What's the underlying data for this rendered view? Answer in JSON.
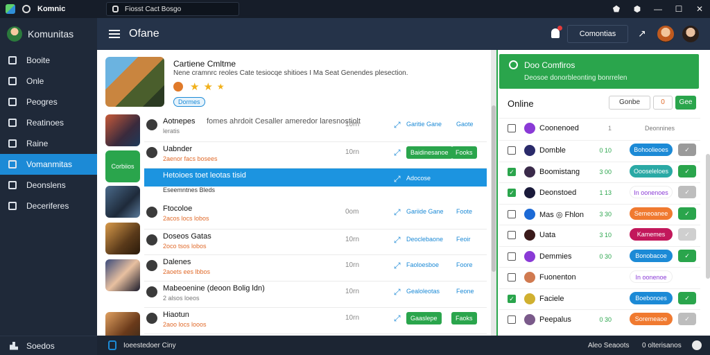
{
  "titlebar": {
    "title": "Komnic",
    "search": "Fiosst Cact Bosgo",
    "controls": [
      "⬟",
      "⬢",
      "—",
      "☐",
      "✕"
    ]
  },
  "sidebar": {
    "user": "Komunitas",
    "items": [
      {
        "label": "Booite",
        "icon": "square-icon"
      },
      {
        "label": "Onle",
        "icon": "circle-icon"
      },
      {
        "label": "Peogres",
        "icon": "tag-icon"
      },
      {
        "label": "Reatinoes",
        "icon": "people-icon"
      },
      {
        "label": "Raine",
        "icon": "badge-icon"
      },
      {
        "label": "Vomanmitas",
        "icon": "globe-icon",
        "active": true
      },
      {
        "label": "Deonslens",
        "icon": "card-icon"
      },
      {
        "label": "Deceriferes",
        "icon": "chat-icon"
      }
    ],
    "footer": "Soedos"
  },
  "header": {
    "title": "Ofane",
    "button": "Comontias",
    "arrow": "↗"
  },
  "featured": {
    "title": "Cartiene Cmltme",
    "desc": "Nene cramnrc reoles Cate tesiocqe shitioes I Ma Seat Genendes plesection.",
    "badge": "Dormes"
  },
  "rows": [
    {
      "name": "Aotnepes",
      "sub": "leratis",
      "sub_gray": true,
      "extra": "fomes ahrdoit Cesaller ameredor laresnostiolt",
      "time": "10rn",
      "link": "Garitie Gane",
      "tag": "Gaote"
    },
    {
      "name": "Uabnder",
      "sub": "2aenor facs bosees",
      "time": "10rn",
      "link": "",
      "gbtn1": "Baidinesanoe",
      "gbtn2": "Fooks"
    },
    {
      "name": "Hetoioes toet leotas tisid",
      "sub": "Eseemntnes Bleds",
      "sub_gray": true,
      "time": "",
      "link": "Adocose",
      "selected": true
    },
    {
      "name": "Ftocoloe",
      "sub": "2acos locs lobos",
      "time": "0om",
      "link": "Gariide Gane",
      "tag": "Foote"
    },
    {
      "name": "Doseos Gatas",
      "sub": "2oco tsos lobos",
      "time": "10rn",
      "link": "Deoclebaone",
      "tag": "Feoir"
    },
    {
      "name": "Dalenes",
      "sub": "2aoets ees lbbos",
      "time": "10rn",
      "link": "Faoloesboe",
      "tag": "Foore"
    },
    {
      "name": "Mabeoenine (deoon Bolig ldn)",
      "sub": "2 alsos loeos",
      "sub_gray": true,
      "time": "10rn",
      "link": "Gealoleotas",
      "tag": "Feone"
    },
    {
      "name": "Hiaotun",
      "sub": "2aoo locs looos",
      "time": "10rn",
      "link": "",
      "gbtn1": "Gaaslepe",
      "gbtn2": "Faoks"
    }
  ],
  "thumb_label": "Corbiios",
  "right": {
    "banner_title": "Doo Comfiros",
    "banner_sub": "Deosoe donorbleonting bonrrelen",
    "title": "Online",
    "option": "Gonbe",
    "num": "0 ",
    "go": "Gee",
    "header_row": {
      "name": "Coonenoed",
      "val": "1",
      "opt": "Deonnines"
    },
    "rows": [
      {
        "name": "Domble",
        "val": "0 10",
        "pill": "Bohoolieoes",
        "pill_color": "#1c8ad6",
        "sq_color": "#9a9a9a",
        "checked": false
      },
      {
        "name": "Boomistang",
        "val": "3 00",
        "pill": "Oooseleloes",
        "pill_color": "#2aa9a5",
        "sq_color": "#2aa54c",
        "checked": true
      },
      {
        "name": "Deonstoed",
        "val": "1 13",
        "pill": "In oonenoes",
        "pill_color": "#ffffff",
        "sq_color": "#bdbdbd",
        "checked": true
      },
      {
        "name": "Mas ◎ Fhlon",
        "val": "3 30",
        "pill": "Semeoanee",
        "pill_color": "#f07a30",
        "sq_color": "#2aa54c",
        "checked": false
      },
      {
        "name": "Uata",
        "val": "3 10",
        "pill": "Kamemes",
        "pill_color": "#c2185b",
        "sq_color": "#cfcfcf",
        "checked": false
      },
      {
        "name": "Demmies",
        "val": "0 30",
        "pill": "Bonobacoe",
        "pill_color": "#1c8ad6",
        "sq_color": "#2aa54c",
        "checked": false
      },
      {
        "name": "Fuonenton",
        "val": "",
        "pill": "In oonenoe",
        "pill_color": "#ffffff",
        "sq_color": "#ffffff",
        "checked": false
      },
      {
        "name": "Faciele",
        "val": "",
        "pill": "Boebonoes",
        "pill_color": "#1c8ad6",
        "sq_color": "#2aa54c",
        "checked": true
      },
      {
        "name": "Peepalus",
        "val": "0 30",
        "pill": "Soremeaoe",
        "pill_color": "#f07a30",
        "sq_color": "#bdbdbd",
        "checked": false
      }
    ]
  },
  "status": {
    "left": "Ioeestedoer Ciny",
    "right1": "Aleo Seaoots",
    "right2": "0 olterisanos"
  },
  "colors": {
    "accent_blue": "#1c8ad6",
    "accent_green": "#2aa54c",
    "sidebar": "#1f2939",
    "header": "#253349"
  }
}
